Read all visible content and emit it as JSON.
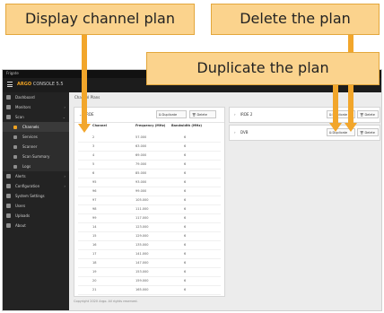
{
  "callouts": {
    "display": "Display channel plan",
    "delete": "Delete the plan",
    "duplicate": "Duplicate the plan"
  },
  "window": {
    "title": "Frigate",
    "right_text": "Logout"
  },
  "brand": {
    "prefix": "ARGO",
    "suffix": "CONSOLE 5.5"
  },
  "sidebar": {
    "items": [
      {
        "label": "Dashboard",
        "icon": "home-icon",
        "chevron": ""
      },
      {
        "label": "Monitors",
        "icon": "monitor-icon",
        "chevron": "›"
      },
      {
        "label": "Scan",
        "icon": "scan-icon",
        "chevron": "⌄"
      },
      {
        "label": "Channels",
        "icon": "channel-icon",
        "chevron": "",
        "sub": true,
        "active": true
      },
      {
        "label": "Services",
        "icon": "list-icon",
        "chevron": "",
        "sub": true
      },
      {
        "label": "Scanner",
        "icon": "scanner-icon",
        "chevron": "",
        "sub": true
      },
      {
        "label": "Scan Summary",
        "icon": "summary-icon",
        "chevron": "",
        "sub": true
      },
      {
        "label": "Logs",
        "icon": "log-icon",
        "chevron": "",
        "sub": true
      },
      {
        "label": "Alerts",
        "icon": "alert-icon",
        "chevron": "›"
      },
      {
        "label": "Configuration",
        "icon": "config-icon",
        "chevron": "›"
      },
      {
        "label": "System Settings",
        "icon": "settings-icon",
        "chevron": ""
      },
      {
        "label": "Users",
        "icon": "users-icon",
        "chevron": ""
      },
      {
        "label": "Uploads",
        "icon": "upload-icon",
        "chevron": ""
      },
      {
        "label": "About",
        "icon": "info-icon",
        "chevron": ""
      }
    ]
  },
  "breadcrumb": {
    "root": "Channel Plans"
  },
  "plans": [
    {
      "name": "IRDE",
      "duplicate_label": "Duplicate",
      "delete_label": "Delete"
    },
    {
      "name": "IRDE 2",
      "duplicate_label": "Duplicate",
      "delete_label": "Delete"
    },
    {
      "name": "DVB",
      "duplicate_label": "Duplicate",
      "delete_label": "Delete"
    }
  ],
  "table": {
    "headers": [
      "Channel",
      "Frequency (MHz)",
      "Bandwidth (MHz)"
    ],
    "rows": [
      [
        "2",
        "57.000",
        "6"
      ],
      [
        "3",
        "63.000",
        "6"
      ],
      [
        "4",
        "69.000",
        "6"
      ],
      [
        "5",
        "79.000",
        "6"
      ],
      [
        "6",
        "85.000",
        "6"
      ],
      [
        "95",
        "93.000",
        "6"
      ],
      [
        "96",
        "99.000",
        "6"
      ],
      [
        "97",
        "105.000",
        "6"
      ],
      [
        "98",
        "111.000",
        "6"
      ],
      [
        "99",
        "117.000",
        "6"
      ],
      [
        "14",
        "123.000",
        "6"
      ],
      [
        "15",
        "129.000",
        "6"
      ],
      [
        "16",
        "135.000",
        "6"
      ],
      [
        "17",
        "141.000",
        "6"
      ],
      [
        "18",
        "147.000",
        "6"
      ],
      [
        "19",
        "153.000",
        "6"
      ],
      [
        "20",
        "159.000",
        "6"
      ],
      [
        "21",
        "165.000",
        "6"
      ]
    ]
  },
  "footer": "Copyright 2020 Argo. All rights reserved.",
  "colors": {
    "accent": "#f0a322",
    "callout_fill": "#fbd38d",
    "arrow": "#f2a62b"
  }
}
